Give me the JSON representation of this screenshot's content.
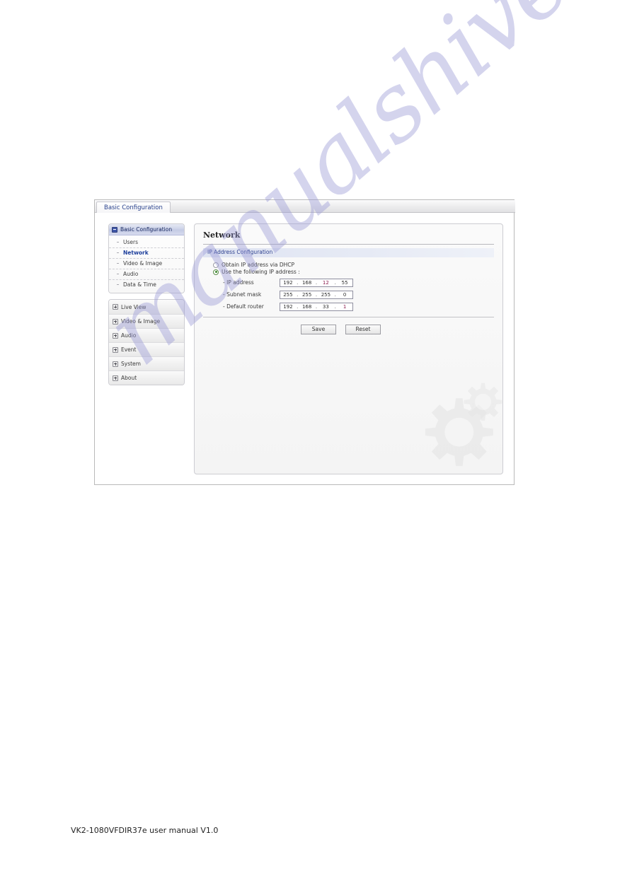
{
  "window": {
    "titlebar_tab": "Basic Configuration"
  },
  "sidebar": {
    "expanded_group": {
      "label": "Basic Configuration",
      "icon": "minus-box-icon",
      "items": [
        {
          "label": "Users",
          "selected": false
        },
        {
          "label": "Network",
          "selected": true
        },
        {
          "label": "Video & Image",
          "selected": false
        },
        {
          "label": "Audio",
          "selected": false
        },
        {
          "label": "Data & Time",
          "selected": false
        }
      ]
    },
    "collapsed_groups": [
      {
        "label": "Live View",
        "icon": "plus-box-icon"
      },
      {
        "label": "Video & Image",
        "icon": "plus-box-icon"
      },
      {
        "label": "Audio",
        "icon": "plus-box-icon"
      },
      {
        "label": "Event",
        "icon": "plus-box-icon"
      },
      {
        "label": "System",
        "icon": "plus-box-icon"
      },
      {
        "label": "About",
        "icon": "plus-box-icon"
      }
    ]
  },
  "content": {
    "page_title": "Network",
    "section_title": "IP Address Configuration",
    "radios": [
      {
        "label": "Obtain IP address via DHCP",
        "checked": false
      },
      {
        "label": "Use the following IP address :",
        "checked": true
      }
    ],
    "fields": [
      {
        "label": "- IP address",
        "octets": [
          "192",
          "168",
          "12",
          "55"
        ],
        "highlight_index": 2
      },
      {
        "label": "- Subnet mask",
        "octets": [
          "255",
          "255",
          "255",
          "0"
        ],
        "highlight_index": -1
      },
      {
        "label": "- Default router",
        "octets": [
          "192",
          "168",
          "33",
          "1"
        ],
        "highlight_index": 3
      }
    ],
    "buttons": {
      "save": "Save",
      "reset": "Reset"
    },
    "decorations": [
      "gear-icon-large",
      "gear-icon-small"
    ]
  },
  "watermark": {
    "text": "manualshive.com",
    "color": "#9a9ad6"
  },
  "footer": {
    "text": "VK2-1080VFDIR37e user manual V1.0"
  }
}
